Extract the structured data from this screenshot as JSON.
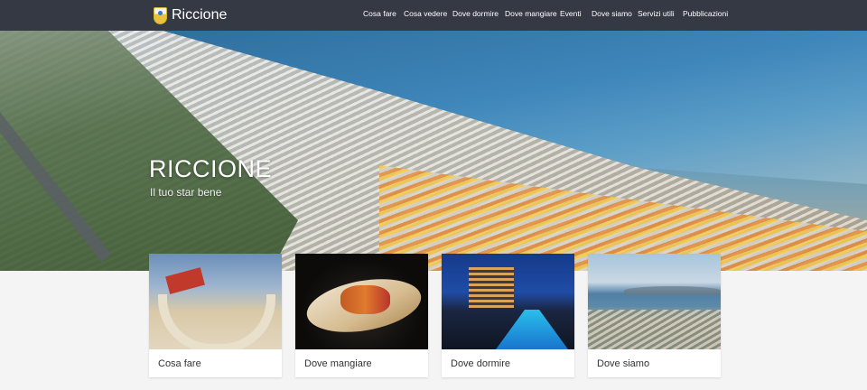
{
  "header": {
    "brand_name": "Riccione",
    "logo_icon": "coat-of-arms-icon",
    "nav": [
      {
        "label": "Cosa fare"
      },
      {
        "label": "Cosa vedere"
      },
      {
        "label": "Dove dormire"
      },
      {
        "label": "Dove mangiare"
      },
      {
        "label": "Eventi"
      },
      {
        "label": "Dove siamo"
      },
      {
        "label": "Servizi utili"
      },
      {
        "label": "Pubblicazioni"
      }
    ]
  },
  "hero": {
    "title": "RICCIONE",
    "subtitle": "Il tuo star bene"
  },
  "cards": [
    {
      "label": "Cosa fare"
    },
    {
      "label": "Dove mangiare"
    },
    {
      "label": "Dove dormire"
    },
    {
      "label": "Dove siamo"
    }
  ],
  "colors": {
    "topbar": "#343943",
    "page_background": "#f4f4f4",
    "card_background": "#ffffff",
    "card_text": "#333333"
  }
}
